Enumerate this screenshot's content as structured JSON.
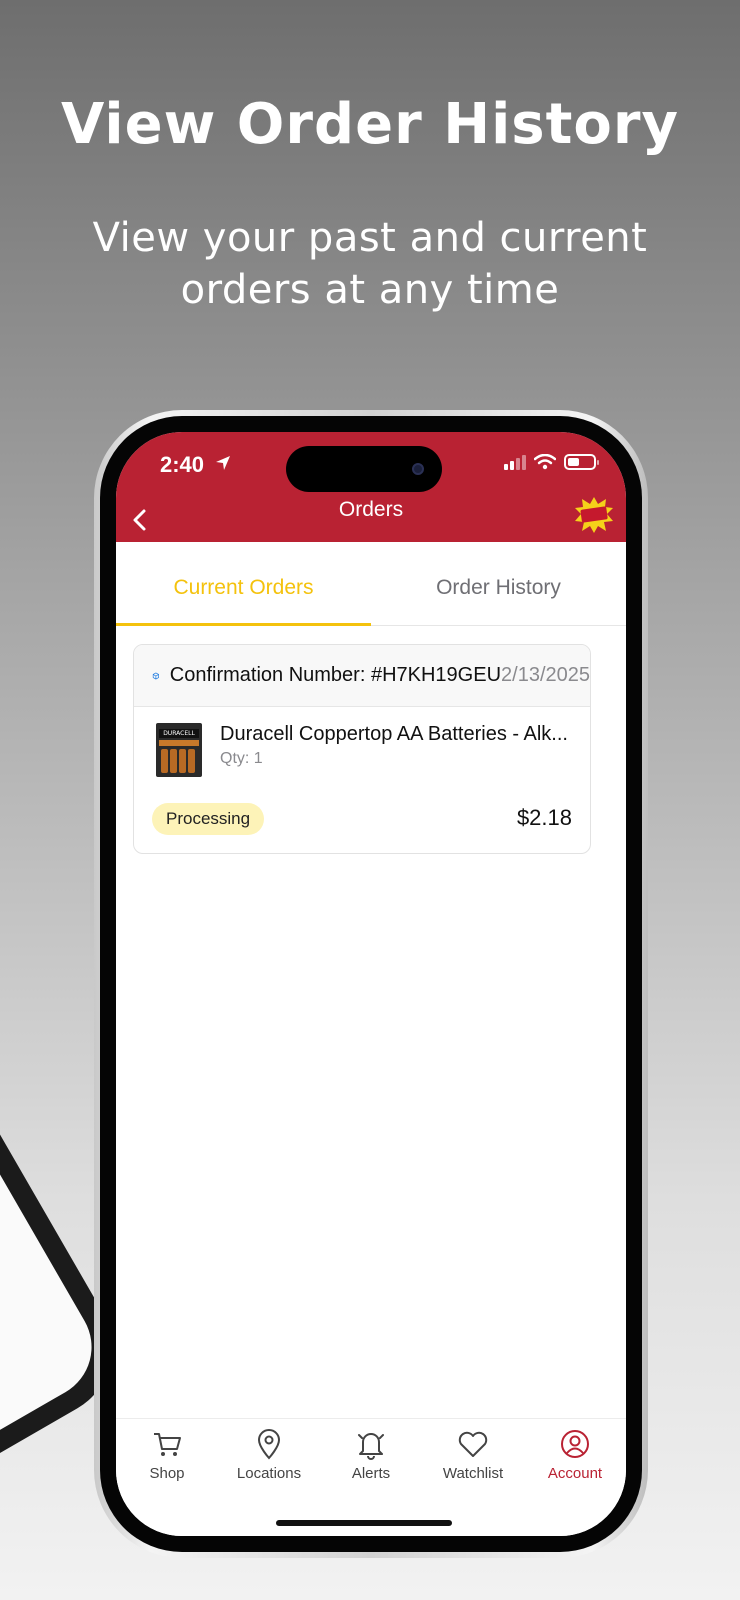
{
  "promo": {
    "headline": "View Order History",
    "subline": "View your past and current orders at any time"
  },
  "status_bar": {
    "time": "2:40"
  },
  "nav": {
    "title": "Orders",
    "logo_text": "THAT'S CHEAP!"
  },
  "tabs": [
    {
      "label": "Current Orders",
      "active": true
    },
    {
      "label": "Order History",
      "active": false
    }
  ],
  "order": {
    "confirmation": "Confirmation Number: #H7KH19GEU",
    "date": "2/13/2025",
    "item_title": "Duracell Coppertop AA Batteries - Alk...",
    "item_thumb_brand": "DURACELL",
    "qty": "Qty: 1",
    "status": "Processing",
    "price": "$2.18"
  },
  "bottom_nav": [
    {
      "label": "Shop",
      "icon": "cart-icon"
    },
    {
      "label": "Locations",
      "icon": "location-pin-icon"
    },
    {
      "label": "Alerts",
      "icon": "bell-icon"
    },
    {
      "label": "Watchlist",
      "icon": "heart-icon"
    },
    {
      "label": "Account",
      "icon": "account-icon",
      "active": true
    }
  ],
  "colors": {
    "brand_red": "#b92233",
    "tab_active": "#f4c20d",
    "status_badge": "#fdf3b8"
  }
}
